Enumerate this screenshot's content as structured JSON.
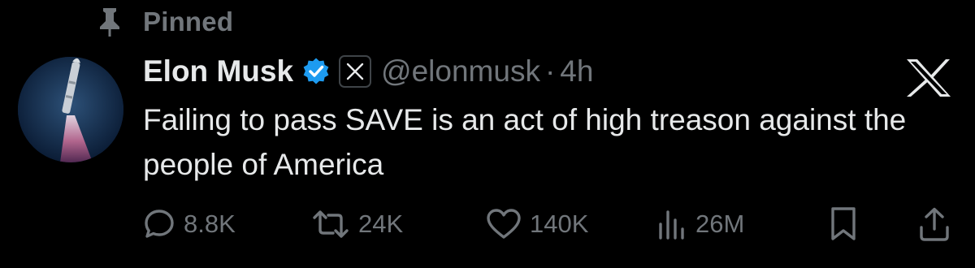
{
  "pinned": {
    "label": "Pinned",
    "icon": "pin-icon"
  },
  "author": {
    "name": "Elon Musk",
    "handle": "@elonmusk",
    "separator": "·",
    "time": "4h",
    "verified_icon": "verified-badge-icon",
    "affiliate_icon": "x-affiliate-icon"
  },
  "tweet": {
    "text": "Failing to pass SAVE is an act of high treason against the people of America"
  },
  "actions": {
    "replies": "8.8K",
    "reposts": "24K",
    "likes": "140K",
    "views": "26M"
  },
  "colors": {
    "background": "#000000",
    "text": "#e7e9ea",
    "muted": "#71767b",
    "verified": "#1d9bf0"
  }
}
